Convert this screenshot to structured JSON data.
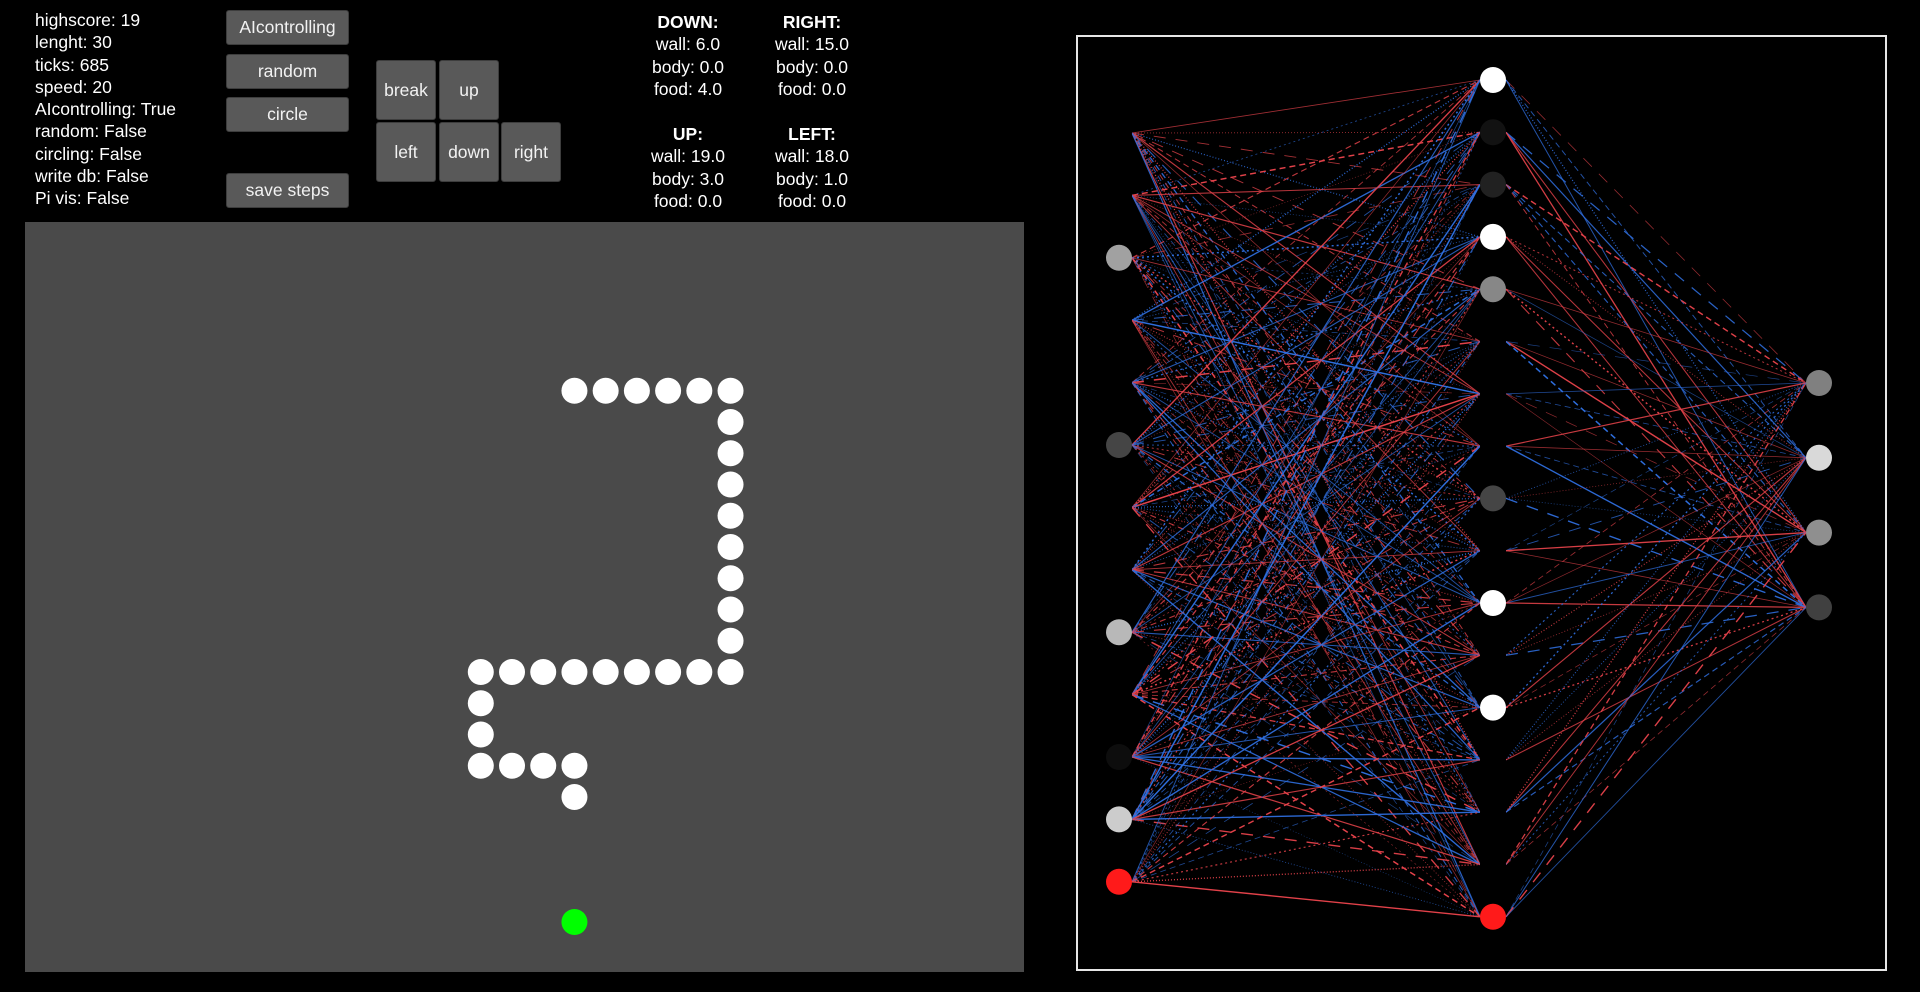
{
  "stats": {
    "lines": [
      "highscore: 19",
      "lenght: 30",
      "ticks: 685",
      "speed: 20",
      "AIcontrolling: True",
      "random: False",
      "circling: False",
      "write db: False",
      "Pi vis: False"
    ]
  },
  "buttons": {
    "ai_controlling": "AIcontrolling",
    "random": "random",
    "circle": "circle",
    "save_steps": "save steps"
  },
  "dpad": {
    "break": "break",
    "up": "up",
    "left": "left",
    "down": "down",
    "right": "right"
  },
  "sensors": {
    "down": {
      "title": "DOWN:",
      "wall": "wall: 6.0",
      "body": "body: 0.0",
      "food": "food: 4.0"
    },
    "right": {
      "title": "RIGHT:",
      "wall": "wall: 15.0",
      "body": "body: 0.0",
      "food": "food: 0.0"
    },
    "up": {
      "title": "UP:",
      "wall": "wall: 19.0",
      "body": "body: 3.0",
      "food": "food: 0.0"
    },
    "left": {
      "title": "LEFT:",
      "wall": "wall: 18.0",
      "body": "body: 1.0",
      "food": "food: 0.0"
    }
  },
  "game": {
    "grid_cols": 32,
    "grid_rows": 24,
    "board_color": "#4a4a4a",
    "snake_color": "#ffffff",
    "food_color": "#00ff00",
    "snake": [
      [
        17,
        5
      ],
      [
        18,
        5
      ],
      [
        19,
        5
      ],
      [
        20,
        5
      ],
      [
        21,
        5
      ],
      [
        22,
        5
      ],
      [
        22,
        6
      ],
      [
        22,
        7
      ],
      [
        22,
        8
      ],
      [
        22,
        9
      ],
      [
        22,
        10
      ],
      [
        22,
        11
      ],
      [
        22,
        12
      ],
      [
        22,
        13
      ],
      [
        22,
        14
      ],
      [
        21,
        14
      ],
      [
        20,
        14
      ],
      [
        19,
        14
      ],
      [
        18,
        14
      ],
      [
        17,
        14
      ],
      [
        16,
        14
      ],
      [
        15,
        14
      ],
      [
        14,
        14
      ],
      [
        14,
        15
      ],
      [
        14,
        16
      ],
      [
        14,
        17
      ],
      [
        15,
        17
      ],
      [
        16,
        17
      ],
      [
        17,
        17
      ],
      [
        17,
        18
      ]
    ],
    "food": [
      17,
      22
    ]
  },
  "network": {
    "positive_color": "#e8434b",
    "negative_color": "#2f6fe0",
    "bias_color": "#ff1a1a",
    "layers": [
      {
        "name": "input",
        "activations": [
          0.0,
          0.0,
          0.63,
          0.0,
          0.0,
          0.27,
          0.0,
          0.0,
          0.72,
          0.0,
          0.05,
          0.8
        ],
        "bias": true
      },
      {
        "name": "hidden",
        "activations": [
          1.0,
          0.07,
          0.13,
          1.0,
          0.53,
          0.0,
          0.0,
          0.0,
          0.27,
          0.0,
          1.0,
          0.0,
          1.0,
          0.0,
          0.0,
          0.0
        ],
        "bias": true
      },
      {
        "name": "output",
        "activations": [
          0.5,
          0.85,
          0.56,
          0.25
        ],
        "bias": false
      }
    ]
  }
}
